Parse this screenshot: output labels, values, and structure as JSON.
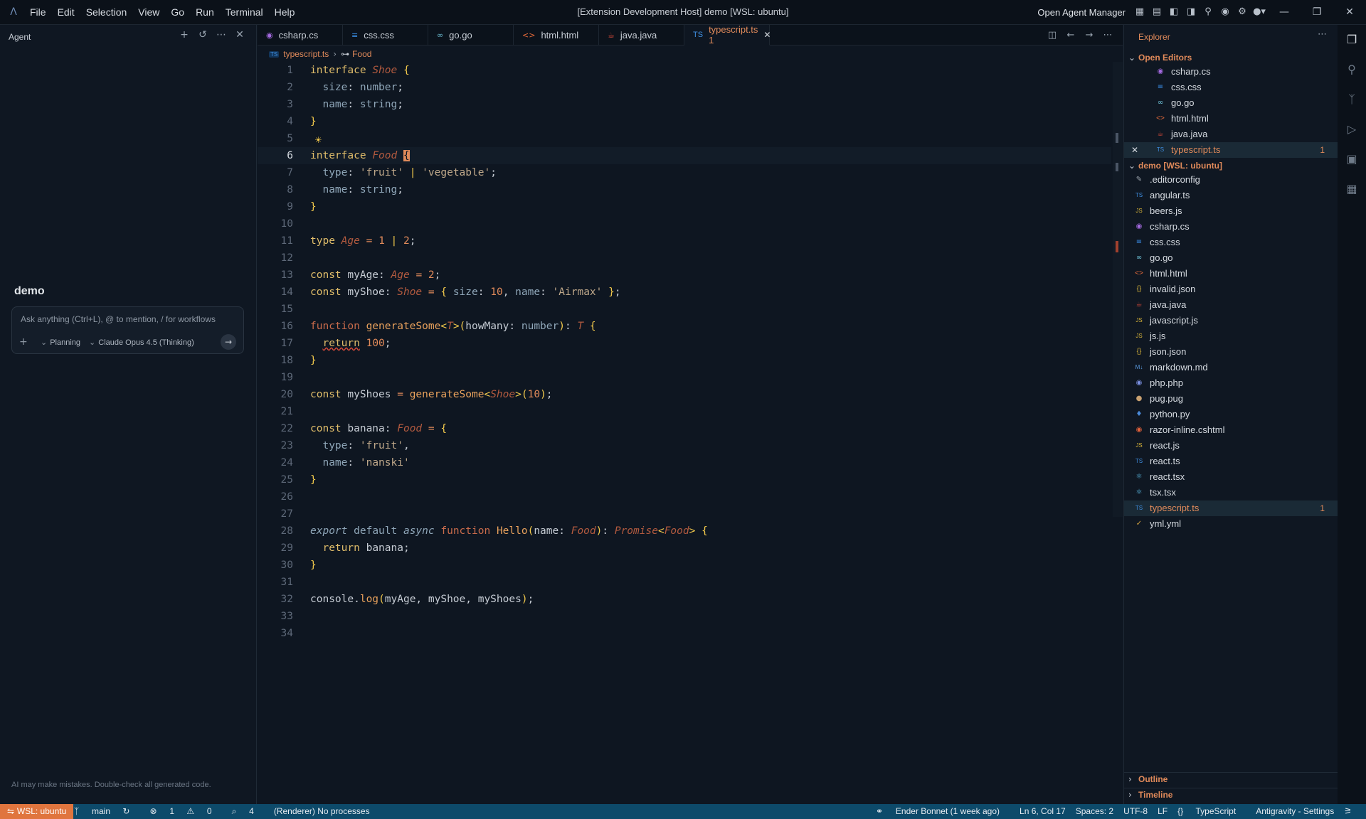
{
  "titlebar": {
    "menu": [
      "File",
      "Edit",
      "Selection",
      "View",
      "Go",
      "Run",
      "Terminal",
      "Help"
    ],
    "window_title": "[Extension Development Host] demo [WSL: ubuntu]",
    "open_agent_manager": "Open Agent Manager"
  },
  "agent": {
    "title": "Agent",
    "workspace": "demo",
    "input_placeholder": "Ask anything (Ctrl+L), @ to mention, / for workflows",
    "mode": "Planning",
    "model": "Claude Opus 4.5 (Thinking)",
    "disclaimer": "AI may make mistakes. Double-check all generated code."
  },
  "tabs": [
    {
      "label": "csharp.cs",
      "icon": "csharp-file-icon",
      "color": "#a46ae0"
    },
    {
      "label": "css.css",
      "icon": "css-file-icon",
      "color": "#3a8ee6"
    },
    {
      "label": "go.go",
      "icon": "go-file-icon",
      "color": "#6fc3d8"
    },
    {
      "label": "html.html",
      "icon": "html-file-icon",
      "color": "#e66a3a"
    },
    {
      "label": "java.java",
      "icon": "java-file-icon",
      "color": "#d64a3a"
    },
    {
      "label": "typescript.ts 1",
      "icon": "typescript-file-icon",
      "color": "#3f8ee0",
      "active": true
    }
  ],
  "breadcrumb": {
    "file": "typescript.ts",
    "symbol": "Food"
  },
  "editor": {
    "current_line": 6
  },
  "explorer": {
    "title": "Explorer",
    "open_editors_label": "Open Editors",
    "open_editors": [
      "csharp.cs",
      "css.css",
      "go.go",
      "html.html",
      "java.java",
      "typescript.ts"
    ],
    "project_label": "demo [WSL: ubuntu]",
    "files": [
      ".editorconfig",
      "angular.ts",
      "beers.js",
      "csharp.cs",
      "css.css",
      "go.go",
      "html.html",
      "invalid.json",
      "java.java",
      "javascript.js",
      "js.js",
      "json.json",
      "markdown.md",
      "php.php",
      "pug.pug",
      "python.py",
      "razor-inline.cshtml",
      "react.js",
      "react.ts",
      "react.tsx",
      "tsx.tsx",
      "typescript.ts",
      "yml.yml"
    ],
    "problem_badge": "1",
    "outline_label": "Outline",
    "timeline_label": "Timeline"
  },
  "statusbar": {
    "remote": "WSL: ubuntu",
    "branch": "main",
    "errors": "1",
    "warnings": "0",
    "ports": "4",
    "renderer": "(Renderer) No processes",
    "blame": "Ender Bonnet (1 week ago)",
    "position": "Ln 6, Col 17",
    "spaces": "Spaces: 2",
    "encoding": "UTF-8",
    "eol": "LF",
    "language": "TypeScript",
    "settings": "Antigravity - Settings"
  }
}
